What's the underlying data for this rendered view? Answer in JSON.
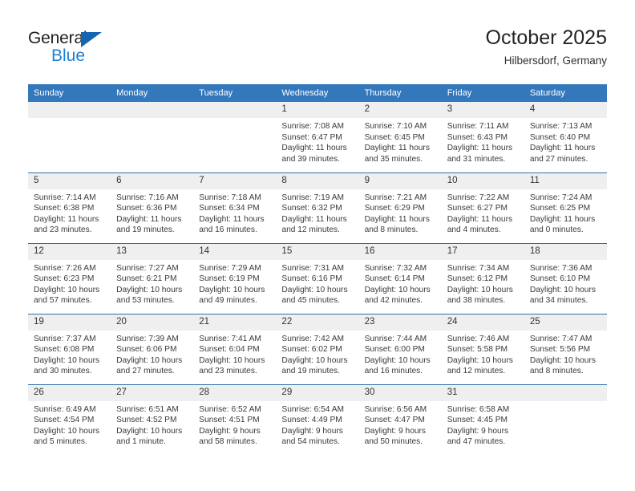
{
  "brand": {
    "name_part1": "General",
    "name_part2": "Blue",
    "triangle_color": "#1565b0",
    "blue_color": "#1b7fd4"
  },
  "header": {
    "title": "October 2025",
    "location": "Hilbersdorf, Germany"
  },
  "theme": {
    "header_bg": "#3478bc",
    "row_divider": "#2f6fa8",
    "daynum_bg": "#efefef",
    "page_bg": "#ffffff"
  },
  "weekdays": [
    "Sunday",
    "Monday",
    "Tuesday",
    "Wednesday",
    "Thursday",
    "Friday",
    "Saturday"
  ],
  "weeks": [
    [
      {
        "day": "",
        "sunrise": "",
        "sunset": "",
        "daylight1": "",
        "daylight2": ""
      },
      {
        "day": "",
        "sunrise": "",
        "sunset": "",
        "daylight1": "",
        "daylight2": ""
      },
      {
        "day": "",
        "sunrise": "",
        "sunset": "",
        "daylight1": "",
        "daylight2": ""
      },
      {
        "day": "1",
        "sunrise": "Sunrise: 7:08 AM",
        "sunset": "Sunset: 6:47 PM",
        "daylight1": "Daylight: 11 hours",
        "daylight2": "and 39 minutes."
      },
      {
        "day": "2",
        "sunrise": "Sunrise: 7:10 AM",
        "sunset": "Sunset: 6:45 PM",
        "daylight1": "Daylight: 11 hours",
        "daylight2": "and 35 minutes."
      },
      {
        "day": "3",
        "sunrise": "Sunrise: 7:11 AM",
        "sunset": "Sunset: 6:43 PM",
        "daylight1": "Daylight: 11 hours",
        "daylight2": "and 31 minutes."
      },
      {
        "day": "4",
        "sunrise": "Sunrise: 7:13 AM",
        "sunset": "Sunset: 6:40 PM",
        "daylight1": "Daylight: 11 hours",
        "daylight2": "and 27 minutes."
      }
    ],
    [
      {
        "day": "5",
        "sunrise": "Sunrise: 7:14 AM",
        "sunset": "Sunset: 6:38 PM",
        "daylight1": "Daylight: 11 hours",
        "daylight2": "and 23 minutes."
      },
      {
        "day": "6",
        "sunrise": "Sunrise: 7:16 AM",
        "sunset": "Sunset: 6:36 PM",
        "daylight1": "Daylight: 11 hours",
        "daylight2": "and 19 minutes."
      },
      {
        "day": "7",
        "sunrise": "Sunrise: 7:18 AM",
        "sunset": "Sunset: 6:34 PM",
        "daylight1": "Daylight: 11 hours",
        "daylight2": "and 16 minutes."
      },
      {
        "day": "8",
        "sunrise": "Sunrise: 7:19 AM",
        "sunset": "Sunset: 6:32 PM",
        "daylight1": "Daylight: 11 hours",
        "daylight2": "and 12 minutes."
      },
      {
        "day": "9",
        "sunrise": "Sunrise: 7:21 AM",
        "sunset": "Sunset: 6:29 PM",
        "daylight1": "Daylight: 11 hours",
        "daylight2": "and 8 minutes."
      },
      {
        "day": "10",
        "sunrise": "Sunrise: 7:22 AM",
        "sunset": "Sunset: 6:27 PM",
        "daylight1": "Daylight: 11 hours",
        "daylight2": "and 4 minutes."
      },
      {
        "day": "11",
        "sunrise": "Sunrise: 7:24 AM",
        "sunset": "Sunset: 6:25 PM",
        "daylight1": "Daylight: 11 hours",
        "daylight2": "and 0 minutes."
      }
    ],
    [
      {
        "day": "12",
        "sunrise": "Sunrise: 7:26 AM",
        "sunset": "Sunset: 6:23 PM",
        "daylight1": "Daylight: 10 hours",
        "daylight2": "and 57 minutes."
      },
      {
        "day": "13",
        "sunrise": "Sunrise: 7:27 AM",
        "sunset": "Sunset: 6:21 PM",
        "daylight1": "Daylight: 10 hours",
        "daylight2": "and 53 minutes."
      },
      {
        "day": "14",
        "sunrise": "Sunrise: 7:29 AM",
        "sunset": "Sunset: 6:19 PM",
        "daylight1": "Daylight: 10 hours",
        "daylight2": "and 49 minutes."
      },
      {
        "day": "15",
        "sunrise": "Sunrise: 7:31 AM",
        "sunset": "Sunset: 6:16 PM",
        "daylight1": "Daylight: 10 hours",
        "daylight2": "and 45 minutes."
      },
      {
        "day": "16",
        "sunrise": "Sunrise: 7:32 AM",
        "sunset": "Sunset: 6:14 PM",
        "daylight1": "Daylight: 10 hours",
        "daylight2": "and 42 minutes."
      },
      {
        "day": "17",
        "sunrise": "Sunrise: 7:34 AM",
        "sunset": "Sunset: 6:12 PM",
        "daylight1": "Daylight: 10 hours",
        "daylight2": "and 38 minutes."
      },
      {
        "day": "18",
        "sunrise": "Sunrise: 7:36 AM",
        "sunset": "Sunset: 6:10 PM",
        "daylight1": "Daylight: 10 hours",
        "daylight2": "and 34 minutes."
      }
    ],
    [
      {
        "day": "19",
        "sunrise": "Sunrise: 7:37 AM",
        "sunset": "Sunset: 6:08 PM",
        "daylight1": "Daylight: 10 hours",
        "daylight2": "and 30 minutes."
      },
      {
        "day": "20",
        "sunrise": "Sunrise: 7:39 AM",
        "sunset": "Sunset: 6:06 PM",
        "daylight1": "Daylight: 10 hours",
        "daylight2": "and 27 minutes."
      },
      {
        "day": "21",
        "sunrise": "Sunrise: 7:41 AM",
        "sunset": "Sunset: 6:04 PM",
        "daylight1": "Daylight: 10 hours",
        "daylight2": "and 23 minutes."
      },
      {
        "day": "22",
        "sunrise": "Sunrise: 7:42 AM",
        "sunset": "Sunset: 6:02 PM",
        "daylight1": "Daylight: 10 hours",
        "daylight2": "and 19 minutes."
      },
      {
        "day": "23",
        "sunrise": "Sunrise: 7:44 AM",
        "sunset": "Sunset: 6:00 PM",
        "daylight1": "Daylight: 10 hours",
        "daylight2": "and 16 minutes."
      },
      {
        "day": "24",
        "sunrise": "Sunrise: 7:46 AM",
        "sunset": "Sunset: 5:58 PM",
        "daylight1": "Daylight: 10 hours",
        "daylight2": "and 12 minutes."
      },
      {
        "day": "25",
        "sunrise": "Sunrise: 7:47 AM",
        "sunset": "Sunset: 5:56 PM",
        "daylight1": "Daylight: 10 hours",
        "daylight2": "and 8 minutes."
      }
    ],
    [
      {
        "day": "26",
        "sunrise": "Sunrise: 6:49 AM",
        "sunset": "Sunset: 4:54 PM",
        "daylight1": "Daylight: 10 hours",
        "daylight2": "and 5 minutes."
      },
      {
        "day": "27",
        "sunrise": "Sunrise: 6:51 AM",
        "sunset": "Sunset: 4:52 PM",
        "daylight1": "Daylight: 10 hours",
        "daylight2": "and 1 minute."
      },
      {
        "day": "28",
        "sunrise": "Sunrise: 6:52 AM",
        "sunset": "Sunset: 4:51 PM",
        "daylight1": "Daylight: 9 hours",
        "daylight2": "and 58 minutes."
      },
      {
        "day": "29",
        "sunrise": "Sunrise: 6:54 AM",
        "sunset": "Sunset: 4:49 PM",
        "daylight1": "Daylight: 9 hours",
        "daylight2": "and 54 minutes."
      },
      {
        "day": "30",
        "sunrise": "Sunrise: 6:56 AM",
        "sunset": "Sunset: 4:47 PM",
        "daylight1": "Daylight: 9 hours",
        "daylight2": "and 50 minutes."
      },
      {
        "day": "31",
        "sunrise": "Sunrise: 6:58 AM",
        "sunset": "Sunset: 4:45 PM",
        "daylight1": "Daylight: 9 hours",
        "daylight2": "and 47 minutes."
      },
      {
        "day": "",
        "sunrise": "",
        "sunset": "",
        "daylight1": "",
        "daylight2": ""
      }
    ]
  ]
}
